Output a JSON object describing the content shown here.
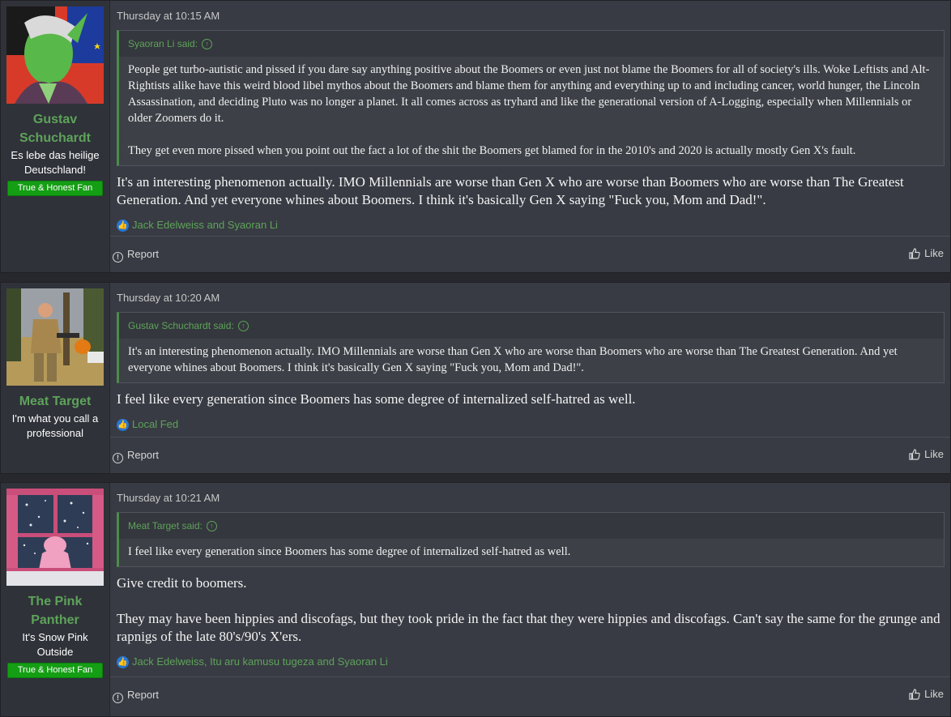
{
  "posts": [
    {
      "user": {
        "name": "Gustav Schuchardt",
        "title": "Es lebe das heilige Deutschland!",
        "badge": "True & Honest Fan"
      },
      "date": "Thursday at 10:15 AM",
      "quote": {
        "author": "Syaoran Li said:",
        "paragraphs": [
          "People get turbo-autistic and pissed if you dare say anything positive about the Boomers or even just not blame the Boomers for all of society's ills. Woke Leftists and Alt-Rightists alike have this weird blood libel mythos about the Boomers and blame them for anything and everything up to and including cancer, world hunger, the Lincoln Assassination, and deciding Pluto was no longer a planet. It all comes across as tryhard and like the generational version of A-Logging, especially when Millennials or older Zoomers do it.",
          "They get even more pissed when you point out the fact a lot of the shit the Boomers get blamed for in the 2010's and 2020 is actually mostly Gen X's fault."
        ]
      },
      "message": [
        "It's an interesting phenomenon actually. IMO Millennials are worse than Gen X who are worse than Boomers who are worse than The Greatest Generation. And yet everyone whines about Boomers. I think it's basically Gen X saying \"Fuck you, Mom and Dad!\"."
      ],
      "reactions": "Jack Edelweiss and Syaoran Li",
      "report": "Report",
      "like": "Like"
    },
    {
      "user": {
        "name": "Meat Target",
        "title": "I'm what you call a professional"
      },
      "date": "Thursday at 10:20 AM",
      "quote": {
        "author": "Gustav Schuchardt said:",
        "paragraphs": [
          "It's an interesting phenomenon actually. IMO Millennials are worse than Gen X who are worse than Boomers who are worse than The Greatest Generation. And yet everyone whines about Boomers. I think it's basically Gen X saying \"Fuck you, Mom and Dad!\"."
        ]
      },
      "message": [
        "I feel like every generation since Boomers has some degree of internalized self-hatred as well."
      ],
      "reactions": "Local Fed",
      "report": "Report",
      "like": "Like"
    },
    {
      "user": {
        "name": "The Pink Panther",
        "title": "It's Snow Pink Outside",
        "badge": "True & Honest Fan"
      },
      "date": "Thursday at 10:21 AM",
      "quote": {
        "author": "Meat Target said:",
        "paragraphs": [
          "I feel like every generation since Boomers has some degree of internalized self-hatred as well."
        ]
      },
      "message": [
        "Give credit to boomers.",
        "They may have been hippies and discofags, but they took pride in the fact that they were hippies and discofags. Can't say the same for the grunge and rapnigs of the late 80's/90's X'ers."
      ],
      "reactions": "Jack Edelweiss, Itu aru kamusu tugeza and Syaoran Li",
      "report": "Report",
      "like": "Like"
    }
  ],
  "colors": {
    "accent": "#5ea35a",
    "badge": "#149e14",
    "reaction": "#2577d8"
  }
}
